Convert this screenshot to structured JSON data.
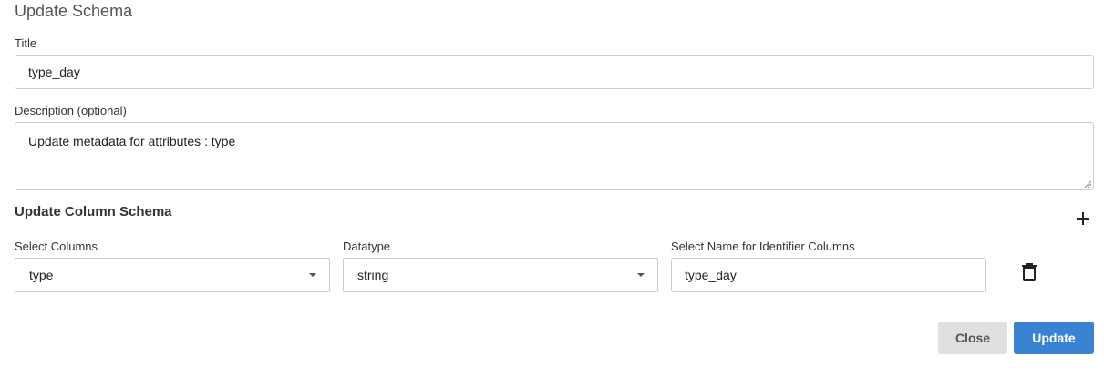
{
  "dialog": {
    "title": "Update Schema"
  },
  "form": {
    "title_label": "Title",
    "title_value": "type_day",
    "description_label": "Description (optional)",
    "description_value": "Update metadata for attributes : type"
  },
  "column_schema": {
    "section_title": "Update Column Schema",
    "add_icon": "plus-icon",
    "delete_icon": "trash-icon",
    "columns_label": "Select Columns",
    "columns_value": "type",
    "datatype_label": "Datatype",
    "datatype_value": "string",
    "identifier_label": "Select Name for Identifier Columns",
    "identifier_value": "type_day"
  },
  "actions": {
    "close_label": "Close",
    "update_label": "Update"
  },
  "colors": {
    "primary": "#3a83d2",
    "secondary": "#e0e0e0"
  }
}
